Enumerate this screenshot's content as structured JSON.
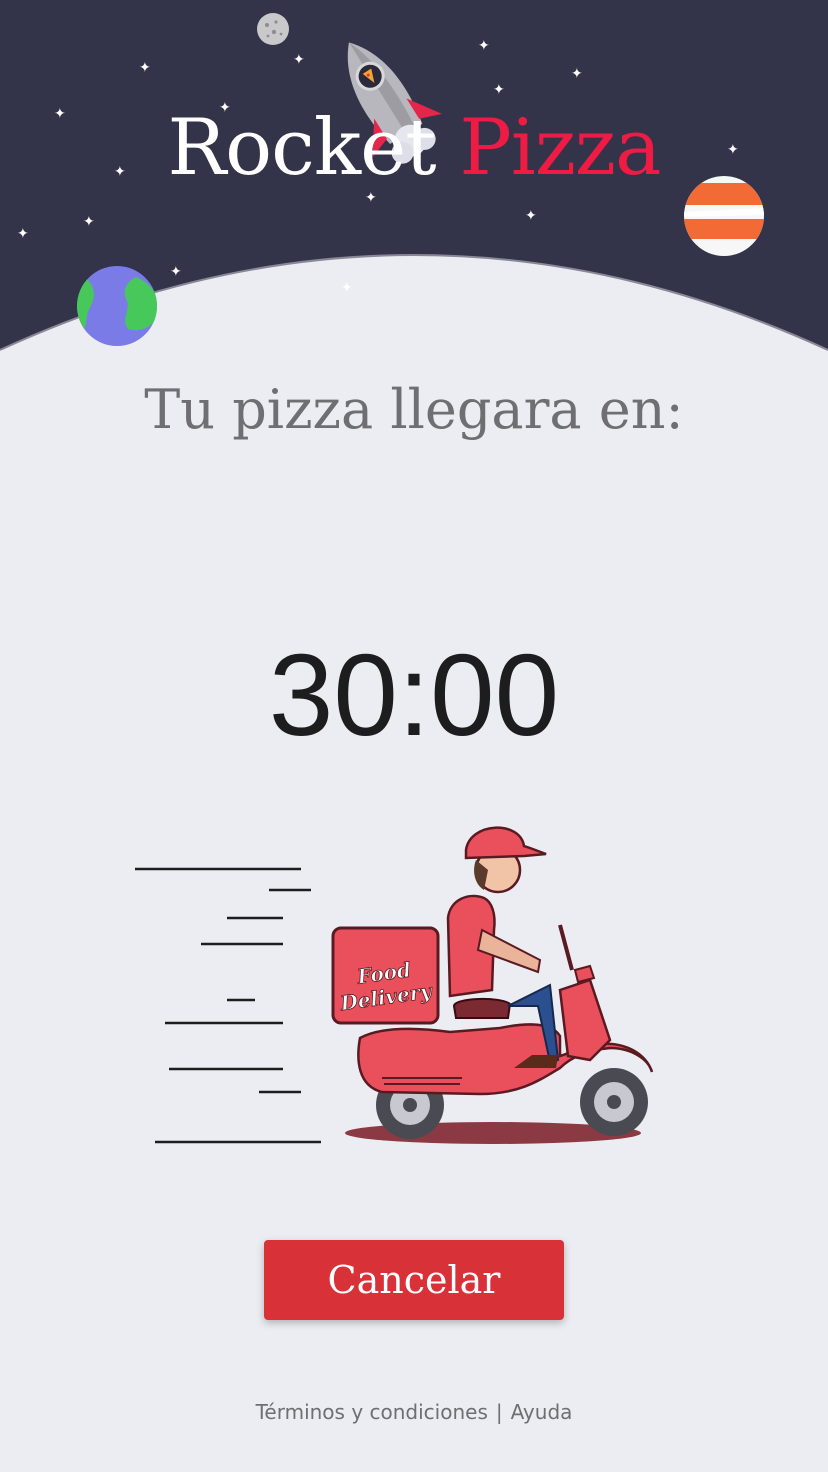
{
  "brand": {
    "word1": "Rocket",
    "word2": "Pizza"
  },
  "main": {
    "subtitle": "Tu pizza llegara en:",
    "timer": "30:00"
  },
  "illustration": {
    "box_text_line1": "Food",
    "box_text_line2": "Delivery"
  },
  "actions": {
    "cancel_label": "Cancelar"
  },
  "footer": {
    "terms_label": "Términos y condiciones",
    "separator": "|",
    "help_label": "Ayuda"
  },
  "colors": {
    "header_bg": "#33334a",
    "accent": "#ee1b44",
    "button": "#d93138",
    "page_bg": "#ecedf2"
  }
}
